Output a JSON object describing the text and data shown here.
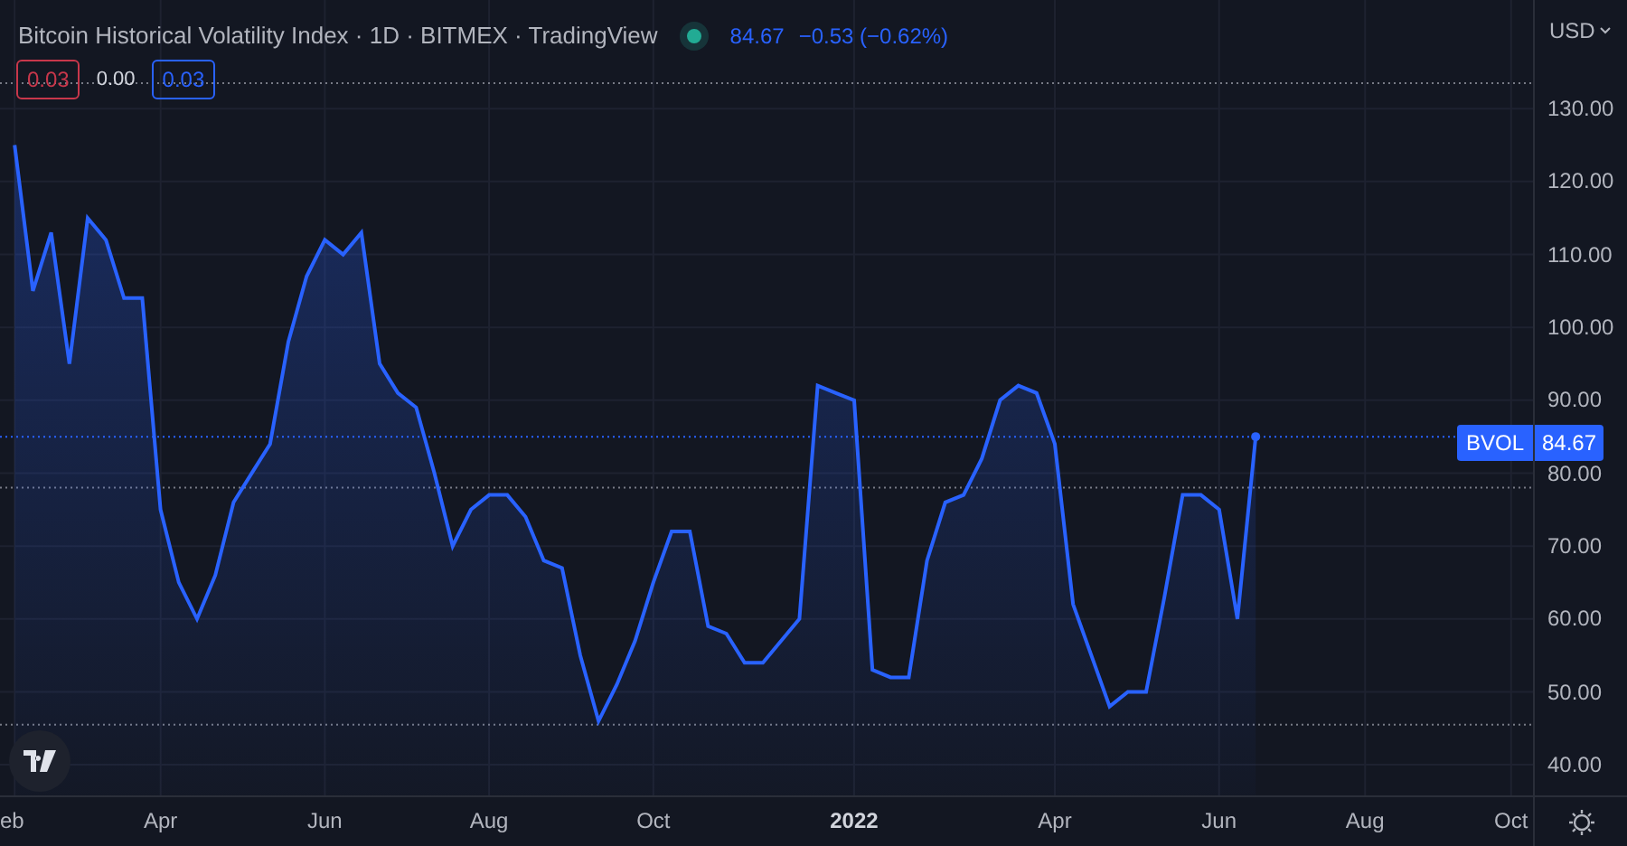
{
  "header": {
    "title": "Bitcoin Historical Volatility Index · 1D · BITMEX · TradingView",
    "last": "84.67",
    "change": "−0.53 (−0.62%)"
  },
  "indicator_values": [
    {
      "text": "0.03",
      "color": "#c8374b",
      "boxed": true
    },
    {
      "text": "0.00",
      "color": "#d1d4dc",
      "boxed": false
    },
    {
      "text": "0.03",
      "color": "#2962ff",
      "boxed": true
    }
  ],
  "price_axis": {
    "currency": "USD"
  },
  "price_label": {
    "value": "84.67"
  },
  "time_axis": {
    "labels": [
      {
        "year": false
      },
      {
        "year": false
      },
      {
        "year": false
      },
      {
        "year": false
      },
      {
        "year": false
      },
      {
        "year": true
      },
      {
        "year": false
      },
      {
        "year": false
      },
      {
        "year": false
      },
      {
        "year": false
      }
    ]
  },
  "chart_data": {
    "type": "area",
    "categories": [
      "eb",
      null,
      null,
      null,
      null,
      null,
      null,
      null,
      "Apr",
      null,
      null,
      null,
      null,
      null,
      null,
      null,
      null,
      "Jun",
      null,
      null,
      null,
      null,
      null,
      null,
      null,
      null,
      "Aug",
      null,
      null,
      null,
      null,
      null,
      null,
      null,
      null,
      "Oct",
      null,
      null,
      null,
      null,
      null,
      null,
      null,
      null,
      null,
      null,
      "2022",
      null,
      null,
      null,
      null,
      null,
      null,
      null,
      null,
      null,
      null,
      "Apr",
      null,
      null,
      null,
      null,
      null,
      null,
      null,
      null,
      "Jun",
      null,
      null,
      null,
      null,
      null,
      null,
      null,
      "Aug",
      null,
      null,
      null,
      null,
      null,
      null,
      null,
      "Oct",
      null
    ],
    "series": [
      {
        "name": "BVOL",
        "color": "#2962ff",
        "values": [
          125,
          105,
          113,
          95,
          115,
          112,
          104,
          104,
          75,
          65,
          60,
          66,
          76,
          80,
          84,
          98,
          107,
          112,
          110,
          113,
          95,
          91,
          89,
          80,
          70,
          75,
          77,
          77,
          74,
          68,
          67,
          55,
          46,
          51,
          57,
          65,
          72,
          72,
          59,
          58,
          54,
          54,
          57,
          60,
          92,
          91,
          90,
          53,
          52,
          52,
          68,
          76,
          77,
          82,
          90,
          92,
          91,
          84,
          62,
          55,
          48,
          50,
          50,
          63,
          77,
          77,
          75,
          60,
          85,
          null,
          null,
          null,
          null,
          null,
          null,
          null,
          null,
          null,
          null,
          null,
          null,
          null,
          null,
          null
        ]
      }
    ],
    "ylim": [
      35.8,
      144.9
    ],
    "grid": true,
    "ref_lines": [
      {
        "axis": "y",
        "value": 133.5,
        "color": "#787b86"
      },
      {
        "axis": "y",
        "value": 85,
        "color": "#2962ff"
      },
      {
        "axis": "y",
        "value": 78,
        "color": "#787b86"
      },
      {
        "axis": "y",
        "value": 45.5,
        "color": "#787b86"
      }
    ],
    "yticks": [
      {
        "value": 40,
        "label": "40.00"
      },
      {
        "value": 50,
        "label": "50.00"
      },
      {
        "value": 60,
        "label": "60.00"
      },
      {
        "value": 70,
        "label": "70.00"
      },
      {
        "value": 80,
        "label": "80.00"
      },
      {
        "value": 90,
        "label": "90.00"
      },
      {
        "value": 100,
        "label": "100.00"
      },
      {
        "value": 110,
        "label": "110.00"
      },
      {
        "value": 120,
        "label": "120.00"
      },
      {
        "value": 130,
        "label": "130.00"
      }
    ]
  }
}
